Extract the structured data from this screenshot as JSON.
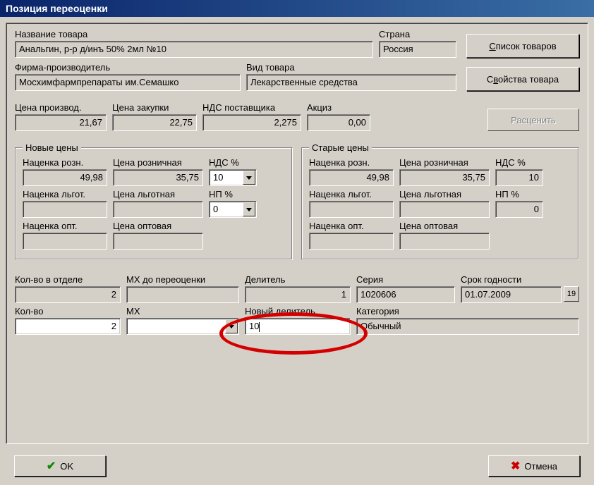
{
  "title": "Позиция переоценки",
  "product": {
    "name_label": "Название товара",
    "name": "Анальгин, р-р д/инъ 50% 2мл №10",
    "country_label": "Страна",
    "country": "Россия",
    "manufacturer_label": "Фирма-производитель",
    "manufacturer": "Мосхимфармпрепараты им.Семашко",
    "type_label": "Вид товара",
    "type": "Лекарственные средства"
  },
  "buttons": {
    "product_list": "Список товаров",
    "product_props": "Свойства товара",
    "rate": "Расценить",
    "ok": "OK",
    "cancel": "Отмена"
  },
  "prices_top": {
    "prod_label": "Цена производ.",
    "prod": "21,67",
    "purch_label": "Цена закупки",
    "purch": "22,75",
    "vat_supplier_label": "НДС поставщика",
    "vat_supplier": "2,275",
    "excise_label": "Акциз",
    "excise": "0,00"
  },
  "new_prices": {
    "legend": "Новые цены",
    "markup_retail_label": "Наценка розн.",
    "markup_retail": "49,98",
    "retail_label": "Цена розничная",
    "retail": "35,75",
    "vat_label": "НДС %",
    "vat": "10",
    "markup_pref_label": "Наценка льгот.",
    "markup_pref": "",
    "pref_label": "Цена льготная",
    "pref": "",
    "np_label": "НП %",
    "np": "0",
    "markup_whole_label": "Наценка опт.",
    "markup_whole": "",
    "whole_label": "Цена оптовая",
    "whole": ""
  },
  "old_prices": {
    "legend": "Старые цены",
    "markup_retail_label": "Наценка розн.",
    "markup_retail": "49,98",
    "retail_label": "Цена розничная",
    "retail": "35,75",
    "vat_label": "НДС %",
    "vat": "10",
    "markup_pref_label": "Наценка льгот.",
    "markup_pref": "",
    "pref_label": "Цена льготная",
    "pref": "",
    "np_label": "НП %",
    "np": "0",
    "markup_whole_label": "Наценка опт.",
    "markup_whole": "",
    "whole_label": "Цена оптовая",
    "whole": ""
  },
  "bottom": {
    "qty_dept_label": "Кол-во в отделе",
    "qty_dept": "2",
    "mh_before_label": "МХ до переоценки",
    "mh_before": "",
    "divider_label": "Делитель",
    "divider": "1",
    "series_label": "Серия",
    "series": "1020606",
    "expiry_label": "Срок годности",
    "expiry": "01.07.2009",
    "qty_label": "Кол-во",
    "qty": "2",
    "mh_label": "МХ",
    "mh": "",
    "new_divider_label": "Новый делитель",
    "new_divider": "10",
    "category_label": "Категория",
    "category": "Обычный"
  },
  "calendar_icon": "19"
}
